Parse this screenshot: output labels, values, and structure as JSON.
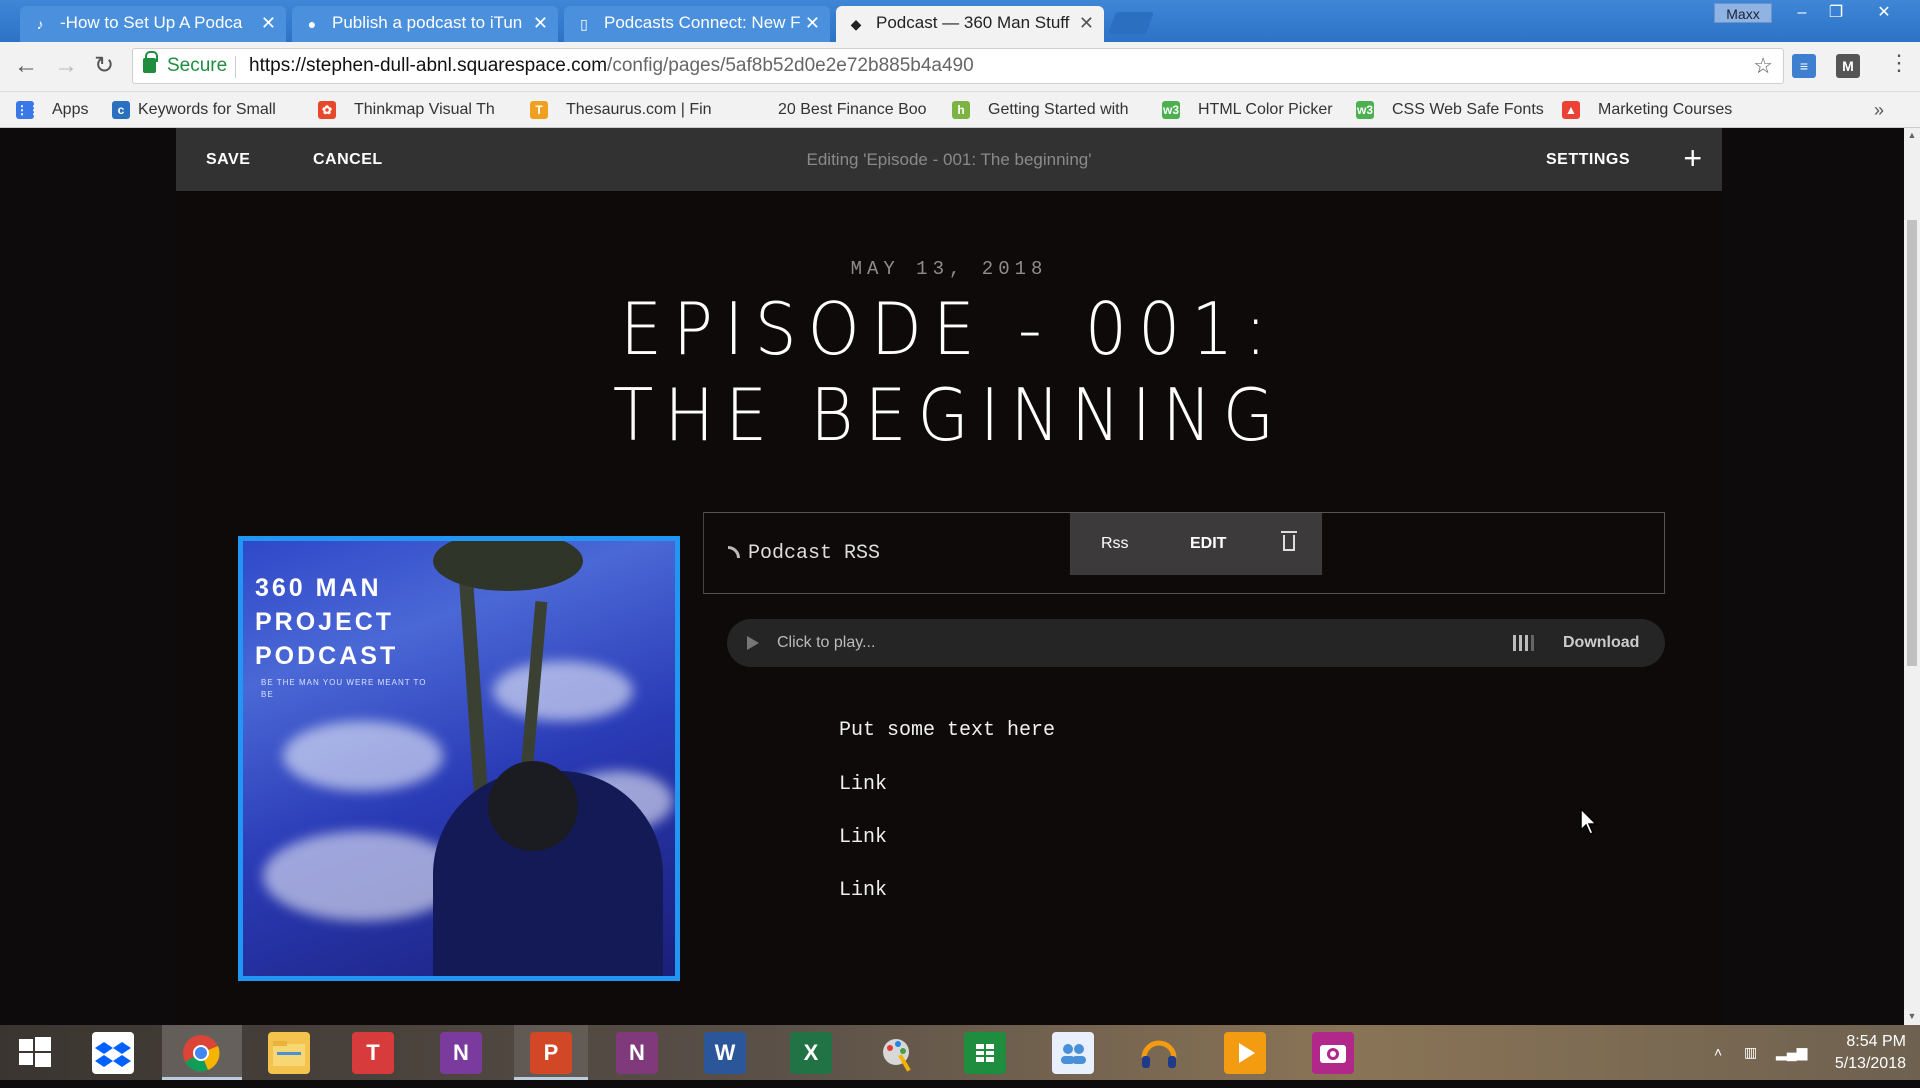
{
  "browser": {
    "tabs": [
      {
        "title": "-How to Set Up A Podca",
        "active": false
      },
      {
        "title": "Publish a podcast to iTun",
        "active": false
      },
      {
        "title": "Podcasts Connect: New F",
        "active": false
      },
      {
        "title": "Podcast — 360 Man Stuff",
        "active": true
      }
    ],
    "window_user": "Maxx",
    "secure_label": "Secure",
    "url_host": "https://stephen-dull-abnl.squarespace.com",
    "url_path": "/config/pages/5af8b52d0e2e72b885b4a490",
    "ext_badge": "M",
    "bookmarks": [
      {
        "label": "Apps",
        "icon": "apps-grid-icon",
        "color": "#3b78e7"
      },
      {
        "label": "Keywords for Small",
        "icon": "keywords-icon",
        "color": "#2a6fc0"
      },
      {
        "label": "Thinkmap Visual Th",
        "icon": "thinkmap-icon",
        "color": "#e8482a"
      },
      {
        "label": "Thesaurus.com | Fin",
        "icon": "thesaurus-icon",
        "color": "#f0a020"
      },
      {
        "label": "20 Best Finance Boo",
        "icon": "finance-icon",
        "color": "#cccccc"
      },
      {
        "label": "Getting Started with",
        "icon": "getting-started-icon",
        "color": "#7cb342"
      },
      {
        "label": "HTML Color Picker",
        "icon": "w3-icon",
        "color": "#4caf50"
      },
      {
        "label": "CSS Web Safe Fonts",
        "icon": "w3-icon",
        "color": "#4caf50"
      },
      {
        "label": "Marketing Courses",
        "icon": "marketing-icon",
        "color": "#ea4335"
      }
    ]
  },
  "editor": {
    "save_label": "SAVE",
    "cancel_label": "CANCEL",
    "editing_title": "Editing 'Episode - 001: The beginning'",
    "settings_label": "SETTINGS"
  },
  "post": {
    "date": "MAY 13, 2018",
    "title_line1": "EPISODE - 001:",
    "title_line2": "THE BEGINNING",
    "cover": {
      "line1": "360 MAN",
      "line2": "PROJECT",
      "line3": "PODCAST",
      "subtitle": "BE THE MAN YOU WERE MEANT TO BE",
      "border_color": "#2196f3"
    },
    "rss_block": {
      "label": "Podcast RSS",
      "tool_rss": "Rss",
      "tool_edit": "EDIT"
    },
    "player": {
      "play_text": "Click to play...",
      "download_label": "Download"
    },
    "body_lines": [
      "Put some text here",
      "Link",
      "Link",
      "Link"
    ]
  },
  "taskbar": {
    "apps": [
      {
        "name": "windows-start-icon",
        "color": "transparent",
        "glyph": ""
      },
      {
        "name": "dropbox-icon",
        "color": "#ffffff",
        "glyph": ""
      },
      {
        "name": "chrome-icon",
        "color": "transparent",
        "glyph": ""
      },
      {
        "name": "file-explorer-icon",
        "color": "#f3c34e",
        "glyph": ""
      },
      {
        "name": "typora-icon",
        "color": "#d83b3b",
        "glyph": "T"
      },
      {
        "name": "onenote-icon",
        "color": "#7a3a9e",
        "glyph": "N"
      },
      {
        "name": "powerpoint-icon",
        "color": "#d24726",
        "glyph": "P"
      },
      {
        "name": "onenote-2-icon",
        "color": "#80397b",
        "glyph": "N"
      },
      {
        "name": "word-icon",
        "color": "#2b579a",
        "glyph": "W"
      },
      {
        "name": "excel-icon",
        "color": "#217346",
        "glyph": "X"
      },
      {
        "name": "paint-icon",
        "color": "transparent",
        "glyph": ""
      },
      {
        "name": "sheets-icon",
        "color": "#1e8e3e",
        "glyph": ""
      },
      {
        "name": "contacts-icon",
        "color": "#e8f0fe",
        "glyph": ""
      },
      {
        "name": "audible-icon",
        "color": "transparent",
        "glyph": ""
      },
      {
        "name": "media-player-icon",
        "color": "#f39c12",
        "glyph": ""
      },
      {
        "name": "camera-icon",
        "color": "#b1278a",
        "glyph": ""
      }
    ],
    "time": "8:54 PM",
    "date": "5/13/2018"
  }
}
